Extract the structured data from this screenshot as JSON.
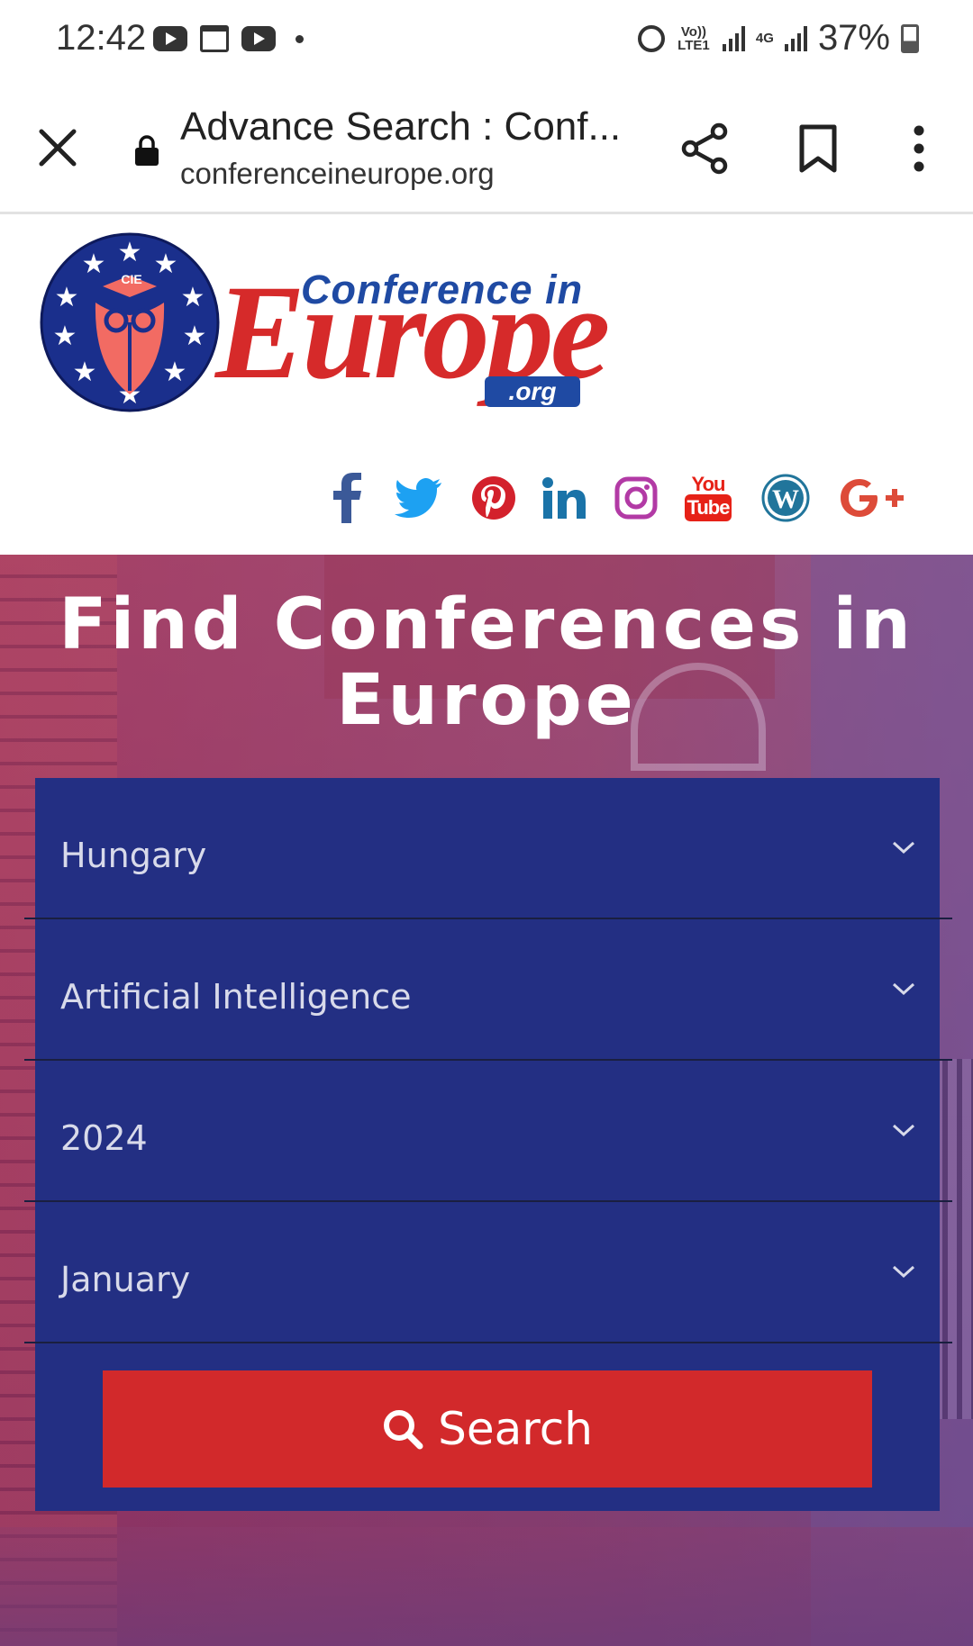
{
  "status_bar": {
    "time": "12:42",
    "battery": "37%",
    "network_label_1": "Vo)) LTE1",
    "network_label_2": "4G"
  },
  "browser": {
    "title": "Advance Search : Conf...",
    "url": "conferenceineurope.org"
  },
  "logo": {
    "badge_text": "CIE",
    "text_top": "Conference in",
    "text_main": "Europe",
    "text_org": ".org"
  },
  "socials": [
    {
      "name": "facebook-icon",
      "color": "#3b5998"
    },
    {
      "name": "twitter-icon",
      "color": "#1da1f2"
    },
    {
      "name": "pinterest-icon",
      "color": "#d3212c"
    },
    {
      "name": "linkedin-icon",
      "color": "#1a73a8"
    },
    {
      "name": "instagram-icon",
      "color": "#b23aa5"
    },
    {
      "name": "youtube-icon",
      "color": "#e62117"
    },
    {
      "name": "wordpress-icon",
      "color": "#21759b"
    },
    {
      "name": "google-plus-icon",
      "color": "#dd4b39"
    }
  ],
  "youtube_label_top": "You",
  "youtube_label_bottom": "Tube",
  "hero": {
    "title": "Find Conferences in Europe"
  },
  "filters": {
    "country": "Hungary",
    "topic": "Artificial Intelligence",
    "year": "2024",
    "month": "January"
  },
  "search_button": {
    "label": "Search"
  },
  "colors": {
    "panel": "#232f83",
    "button": "#d2292b",
    "logo_red": "#d62a2a",
    "logo_blue": "#1f4aa3"
  }
}
